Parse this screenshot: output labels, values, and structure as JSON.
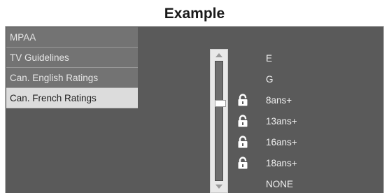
{
  "header": {
    "title": "Example"
  },
  "menu": {
    "items": [
      {
        "label": "MPAA",
        "selected": false
      },
      {
        "label": "TV Guidelines",
        "selected": false
      },
      {
        "label": "Can. English Ratings",
        "selected": false
      },
      {
        "label": "Can. French Ratings",
        "selected": true
      }
    ]
  },
  "ratings": [
    {
      "label": "E",
      "locked": false
    },
    {
      "label": "G",
      "locked": false
    },
    {
      "label": "8ans+",
      "locked": true
    },
    {
      "label": "13ans+",
      "locked": true
    },
    {
      "label": "16ans+",
      "locked": true
    },
    {
      "label": "18ans+",
      "locked": true
    },
    {
      "label": "NONE",
      "locked": false
    }
  ],
  "slider": {
    "selected_index": 2,
    "levels": 7
  },
  "colors": {
    "screen_bg": "#5a5a5a",
    "menu_bg": "#737373",
    "menu_selected_bg": "#dcdcdc",
    "text": "#f0f0f0"
  }
}
